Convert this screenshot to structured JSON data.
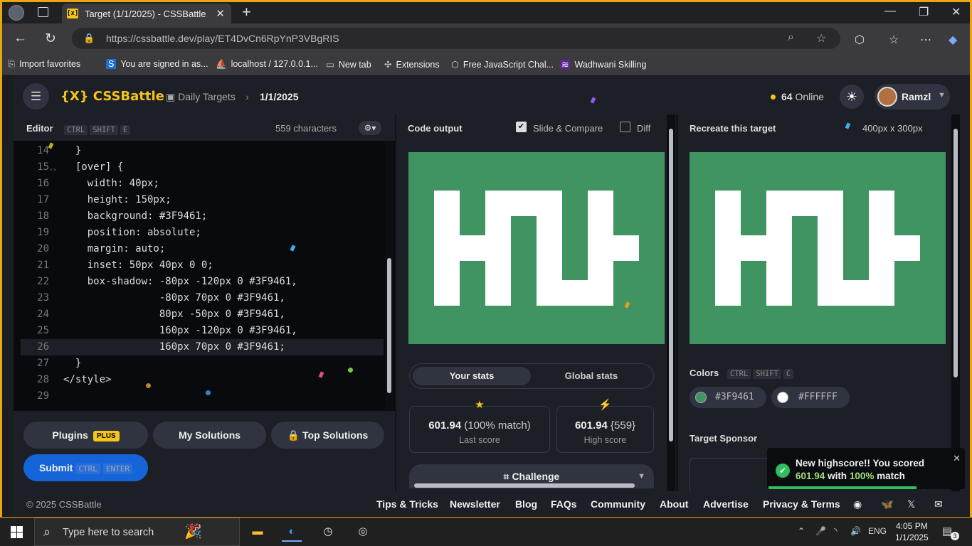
{
  "browser": {
    "tab_title": "Target (1/1/2025) - CSSBattle",
    "tab_favicon": "[x]",
    "url": "https://cssbattle.dev/play/ET4DvCn6RpYnP3VBgRIS",
    "favorites": [
      "Import favorites",
      "You are signed in as...",
      "localhost / 127.0.0.1...",
      "New tab",
      "Extensions",
      "Free JavaScript Chal...",
      "Wadhwani Skilling"
    ]
  },
  "header": {
    "logo": "{X} CSSBattle",
    "crumb_parent": "Daily Targets",
    "crumb_current": "1/1/2025",
    "online_count": "64",
    "online_label": "Online",
    "username": "Ramzl"
  },
  "editor": {
    "title": "Editor",
    "keys": [
      "CTRL",
      "SHIFT",
      "E"
    ],
    "char_count": "559 characters",
    "lines": [
      {
        "num": "14",
        "fold": "",
        "text": "  }"
      },
      {
        "num": "15",
        "fold": "⌄⌄",
        "text": "  [over] {"
      },
      {
        "num": "16",
        "fold": "",
        "text": "    width: 40px;"
      },
      {
        "num": "17",
        "fold": "",
        "text": "    height: 150px;"
      },
      {
        "num": "18",
        "fold": "",
        "text": "    background: #3F9461;"
      },
      {
        "num": "19",
        "fold": "",
        "text": "    position: absolute;"
      },
      {
        "num": "20",
        "fold": "",
        "text": "    margin: auto;"
      },
      {
        "num": "21",
        "fold": "",
        "text": "    inset: 50px 40px 0 0;"
      },
      {
        "num": "22",
        "fold": "",
        "text": "    box-shadow: -80px -120px 0 #3F9461,"
      },
      {
        "num": "23",
        "fold": "",
        "text": "                -80px 70px 0 #3F9461,"
      },
      {
        "num": "24",
        "fold": "",
        "text": "                80px -50px 0 #3F9461,"
      },
      {
        "num": "25",
        "fold": "",
        "text": "                160px -120px 0 #3F9461,"
      },
      {
        "num": "26",
        "fold": "",
        "text": "                160px 70px 0 #3F9461;"
      },
      {
        "num": "27",
        "fold": "",
        "text": "  }"
      },
      {
        "num": "28",
        "fold": "",
        "text": "</style>"
      },
      {
        "num": "29",
        "fold": "",
        "text": ""
      }
    ],
    "buttons": {
      "plugins": "Plugins",
      "plugins_badge": "PLUS",
      "my_solutions": "My Solutions",
      "top_solutions": "Top Solutions",
      "submit": "Submit",
      "submit_keys": [
        "CTRL",
        "ENTER"
      ]
    }
  },
  "output": {
    "title": "Code output",
    "slide_compare": "Slide & Compare",
    "slide_compare_checked": true,
    "diff": "Diff",
    "diff_checked": false,
    "tab_your": "Your stats",
    "tab_global": "Global stats",
    "last_score_value": "601.94",
    "last_score_match": "(100% match)",
    "last_score_label": "Last score",
    "high_score_value": "601.94",
    "high_score_chars": "{559}",
    "high_score_label": "High score",
    "challenge": "Challenge"
  },
  "target": {
    "title": "Recreate this target",
    "size": "400px x 300px",
    "colors_label": "Colors",
    "colors_keys": [
      "CTRL",
      "SHIFT",
      "C"
    ],
    "colors": [
      "#3F9461",
      "#FFFFFF"
    ],
    "sponsor_label": "Target Sponsor"
  },
  "footer": {
    "copyright": "© 2025 CSSBattle",
    "links": [
      "Tips & Tricks",
      "Newsletter",
      "Blog",
      "FAQs",
      "Community",
      "About",
      "Advertise",
      "Privacy & Terms"
    ]
  },
  "toast": {
    "line1": "New highscore!! You scored",
    "score": "601.94",
    "with": "with",
    "match": "100%",
    "match_word": "match"
  },
  "taskbar": {
    "search_placeholder": "Type here to search",
    "lang": "ENG",
    "time": "4:05 PM",
    "date": "1/1/2025",
    "notif_count": "3"
  }
}
